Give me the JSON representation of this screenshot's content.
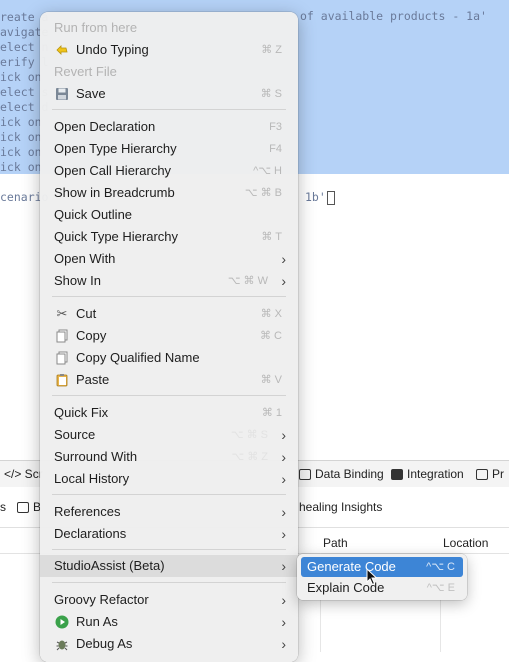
{
  "editor": {
    "lines": [
      "reate a",
      "avigate",
      "elect n",
      "erify l",
      "ick on",
      "elect s",
      "elect d",
      "ick on",
      "ick on",
      "ick on",
      "ick on"
    ],
    "line1_right": "of available products - 1a'",
    "scenario_left": "cenario",
    "scenario_right": "1b'"
  },
  "bottom_tabs": {
    "script_tab": "</> Scr",
    "data_binding": "Data Binding",
    "integration": "Integration",
    "pr": "Pr",
    "healing_insights": "healing Insights",
    "col_path": "Path",
    "col_location": "Location"
  },
  "context_menu": {
    "run_from_here": "Run from here",
    "undo_typing": {
      "label": "Undo Typing",
      "shortcut": "⌘ Z"
    },
    "revert_file": "Revert File",
    "save": {
      "label": "Save",
      "shortcut": "⌘ S"
    },
    "open_declaration": {
      "label": "Open Declaration",
      "shortcut": "F3"
    },
    "open_type_hierarchy": {
      "label": "Open Type Hierarchy",
      "shortcut": "F4"
    },
    "open_call_hierarchy": {
      "label": "Open Call Hierarchy",
      "shortcut": "^⌥ H"
    },
    "show_in_breadcrumb": {
      "label": "Show in Breadcrumb",
      "shortcut": "⌥ ⌘ B"
    },
    "quick_outline": {
      "label": "Quick Outline"
    },
    "quick_type_hierarchy": {
      "label": "Quick Type Hierarchy",
      "shortcut": "⌘ T"
    },
    "open_with": {
      "label": "Open With"
    },
    "show_in": {
      "label": "Show In",
      "shortcut": "⌥ ⌘ W"
    },
    "cut": {
      "label": "Cut",
      "shortcut": "⌘ X"
    },
    "copy": {
      "label": "Copy",
      "shortcut": "⌘ C"
    },
    "copy_qualified_name": {
      "label": "Copy Qualified Name"
    },
    "paste": {
      "label": "Paste",
      "shortcut": "⌘ V"
    },
    "quick_fix": {
      "label": "Quick Fix",
      "shortcut": "⌘ 1"
    },
    "source": {
      "label": "Source",
      "shortcut": "⌥ ⌘ S"
    },
    "surround_with": {
      "label": "Surround With",
      "shortcut": "⌥ ⌘ Z"
    },
    "local_history": {
      "label": "Local History"
    },
    "references": {
      "label": "References"
    },
    "declarations": {
      "label": "Declarations"
    },
    "studio_assist": {
      "label": "StudioAssist (Beta)"
    },
    "groovy_refactor": {
      "label": "Groovy Refactor"
    },
    "run_as": {
      "label": "Run As"
    },
    "debug_as": {
      "label": "Debug As"
    }
  },
  "submenu": {
    "generate_code": {
      "label": "Generate Code",
      "shortcut": "^⌥ C"
    },
    "explain_code": {
      "label": "Explain Code",
      "shortcut": "^⌥ E"
    }
  },
  "colors": {
    "selection": "#b5d2f7",
    "menu_bg": "#eeeeee",
    "submenu_highlight": "#3d85d6"
  }
}
